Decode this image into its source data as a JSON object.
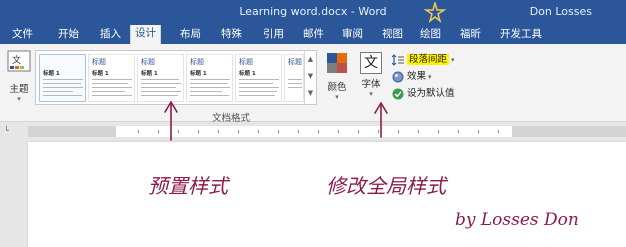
{
  "window": {
    "title": "Learning word.docx - Word",
    "user": "Don Losses"
  },
  "tabs": [
    {
      "label": "文件",
      "active": false
    },
    {
      "label": "开始",
      "active": false
    },
    {
      "label": "插入",
      "active": false
    },
    {
      "label": "设计",
      "active": true
    },
    {
      "label": "布局",
      "active": false
    },
    {
      "label": "特殊",
      "active": false
    },
    {
      "label": "引用",
      "active": false
    },
    {
      "label": "邮件",
      "active": false
    },
    {
      "label": "审阅",
      "active": false
    },
    {
      "label": "视图",
      "active": false
    },
    {
      "label": "绘图",
      "active": false
    },
    {
      "label": "福昕",
      "active": false
    },
    {
      "label": "开发工具",
      "active": false
    }
  ],
  "ribbon": {
    "theme_label": "主题",
    "gallery_items": [
      {
        "title": "",
        "heading": "标题 1"
      },
      {
        "title": "标题",
        "heading": "标题 1"
      },
      {
        "title": "标题",
        "heading": "标题 1"
      },
      {
        "title": "标题",
        "heading": "标题 1"
      },
      {
        "title": "标题",
        "heading": "标题 1"
      },
      {
        "title": "标题",
        "heading": "标题 1"
      }
    ],
    "group_label": "文档格式",
    "colors_label": "颜色",
    "fonts_label": "字体",
    "font_icon_char": "文",
    "paragraph_spacing_label": "段落间距",
    "effects_label": "效果",
    "set_default_label": "设为默认值",
    "accent_color": "#2b579a",
    "highlight_color": "#fff200"
  },
  "annotations": {
    "left": "预置样式",
    "middle": "修改全局样式",
    "signature": "by Losses Don",
    "color": "#8b1c4d"
  }
}
